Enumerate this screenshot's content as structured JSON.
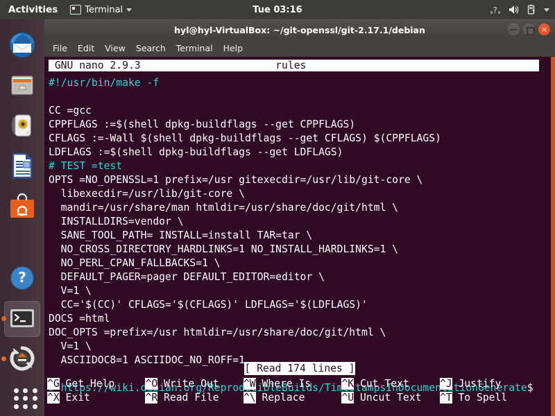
{
  "topbar": {
    "activities": "Activities",
    "app_name": "Terminal",
    "clock": "Tue 03:16",
    "icons": [
      "network-icon",
      "volume-icon",
      "battery-icon",
      "caret-down-icon"
    ]
  },
  "launcher": {
    "items": [
      {
        "name": "thunderbird",
        "label": "Thunderbird Mail",
        "active": false,
        "running": false
      },
      {
        "name": "files",
        "label": "Files",
        "active": false,
        "running": false
      },
      {
        "name": "rhythmbox",
        "label": "Rhythmbox",
        "active": false,
        "running": false
      },
      {
        "name": "libreoffice-writer",
        "label": "LibreOffice Writer",
        "active": false,
        "running": false
      },
      {
        "name": "ubuntu-software",
        "label": "Ubuntu Software",
        "active": false,
        "running": false
      },
      {
        "name": "help",
        "label": "Help",
        "active": false,
        "running": false
      },
      {
        "name": "terminal",
        "label": "Terminal",
        "active": true,
        "running": true
      },
      {
        "name": "software-updater",
        "label": "Software Updater",
        "active": false,
        "running": true
      },
      {
        "name": "show-applications",
        "label": "Show Applications",
        "active": false,
        "running": false
      }
    ]
  },
  "window": {
    "title": "hyl@hyl-VirtualBox: ~/git-openssl/git-2.17.1/debian",
    "controls": {
      "minimize": "–",
      "maximize": "□",
      "close": "×"
    },
    "menu": [
      "File",
      "Edit",
      "View",
      "Search",
      "Terminal",
      "Help"
    ]
  },
  "nano": {
    "version_label": "GNU nano 2.9.3",
    "filename": "rules",
    "status_message": "[ Read 174 lines ]",
    "lines": [
      {
        "text": "#!/usr/bin/make -f",
        "color": "cyan"
      },
      {
        "text": "",
        "color": "white"
      },
      {
        "text": "CC =gcc",
        "color": "white"
      },
      {
        "text": "CPPFLAGS :=$(shell dpkg-buildflags --get CPPFLAGS)",
        "color": "white"
      },
      {
        "text": "CFLAGS :=-Wall $(shell dpkg-buildflags --get CFLAGS) $(CPPFLAGS)",
        "color": "white"
      },
      {
        "text": "LDFLAGS :=$(shell dpkg-buildflags --get LDFLAGS)",
        "color": "white"
      },
      {
        "text": "# TEST =test",
        "color": "cyan"
      },
      {
        "text": "OPTS =NO_OPENSSL=1 prefix=/usr gitexecdir=/usr/lib/git-core \\",
        "color": "white"
      },
      {
        "text": "  libexecdir=/usr/lib/git-core \\",
        "color": "white"
      },
      {
        "text": "  mandir=/usr/share/man htmldir=/usr/share/doc/git/html \\",
        "color": "white"
      },
      {
        "text": "  INSTALLDIRS=vendor \\",
        "color": "white"
      },
      {
        "text": "  SANE_TOOL_PATH= INSTALL=install TAR=tar \\",
        "color": "white"
      },
      {
        "text": "  NO_CROSS_DIRECTORY_HARDLINKS=1 NO_INSTALL_HARDLINKS=1 \\",
        "color": "white"
      },
      {
        "text": "  NO_PERL_CPAN_FALLBACKS=1 \\",
        "color": "white"
      },
      {
        "text": "  DEFAULT_PAGER=pager DEFAULT_EDITOR=editor \\",
        "color": "white"
      },
      {
        "text": "  V=1 \\",
        "color": "white"
      },
      {
        "text": "  CC='$(CC)' CFLAGS='$(CFLAGS)' LDFLAGS='$(LDFLAGS)'",
        "color": "white"
      },
      {
        "text": "DOCS =html",
        "color": "white"
      },
      {
        "text": "DOC_OPTS =prefix=/usr htmldir=/usr/share/doc/git/html \\",
        "color": "white"
      },
      {
        "text": "  V=1 \\",
        "color": "white"
      },
      {
        "text": "  ASCIIDOC8=1 ASCIIDOC_NO_ROFF=1",
        "color": "white"
      },
      {
        "text": "",
        "color": "white"
      },
      {
        "text": "# https://wiki.debian.org/ReproducibleBuilds/TimestampsInDocumentationGenerate",
        "color": "cyan",
        "continuation": "$"
      }
    ],
    "shortcuts": [
      {
        "key": "^G",
        "label": "Get Help"
      },
      {
        "key": "^O",
        "label": "Write Out"
      },
      {
        "key": "^W",
        "label": "Where Is"
      },
      {
        "key": "^K",
        "label": "Cut Text"
      },
      {
        "key": "^J",
        "label": "Justify"
      },
      {
        "key": "^X",
        "label": "Exit"
      },
      {
        "key": "^R",
        "label": "Read File"
      },
      {
        "key": "^\\",
        "label": "Replace"
      },
      {
        "key": "^U",
        "label": "Uncut Text"
      },
      {
        "key": "^T",
        "label": "To Spell"
      }
    ]
  },
  "colors": {
    "terminal_bg": "#300a24",
    "comment": "#2fd5d5",
    "text": "#ffffff",
    "titlebar": "#4a4641",
    "topbar": "#3c3b37",
    "accent_orange": "#e8631b",
    "scrollbar": "#c4572b"
  }
}
